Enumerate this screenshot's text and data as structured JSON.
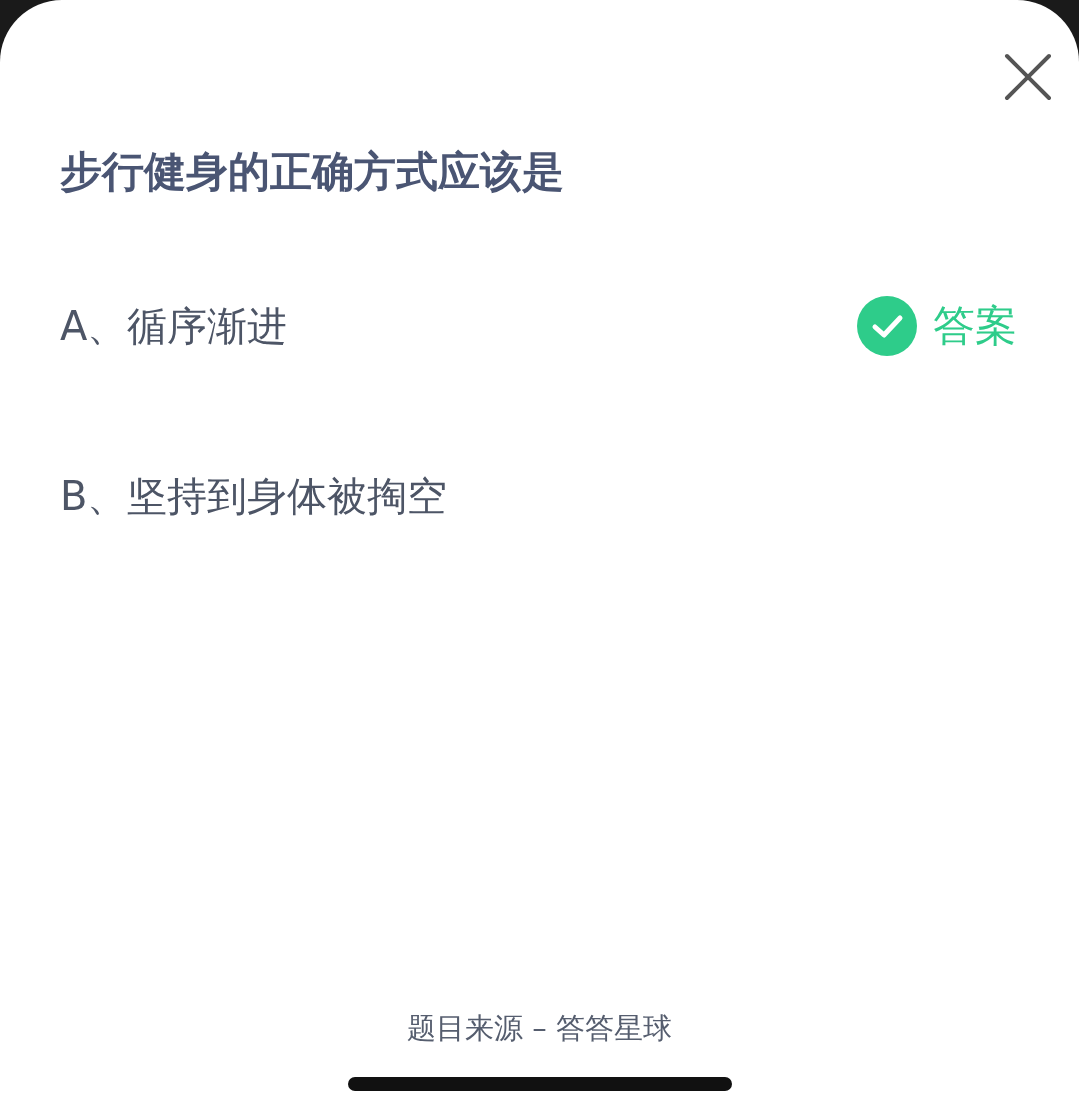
{
  "question": {
    "title": "步行健身的正确方式应该是"
  },
  "options": [
    {
      "label": "A、循序渐进",
      "correct": true,
      "badge": "答案"
    },
    {
      "label": "B、坚持到身体被掏空",
      "correct": false
    }
  ],
  "footer": {
    "source": "题目来源 – 答答星球"
  }
}
